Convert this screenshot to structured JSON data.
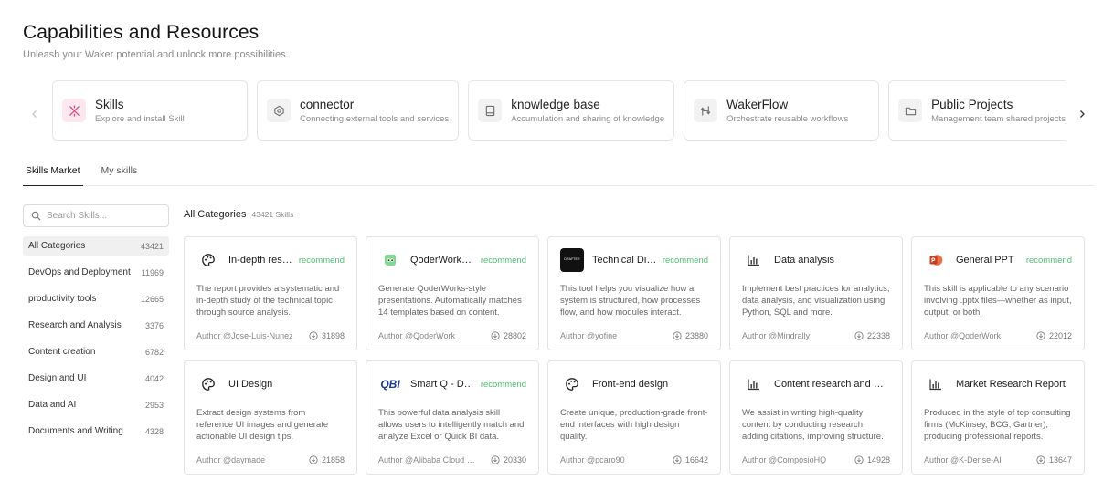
{
  "header": {
    "title": "Capabilities and Resources",
    "subtitle": "Unleash your Waker potential and unlock more possibilities."
  },
  "features": [
    {
      "title": "Skills",
      "desc": "Explore and install Skill",
      "icon": "sparkle-icon",
      "active": true
    },
    {
      "title": "connector",
      "desc": "Connecting external tools and services",
      "icon": "connector-icon"
    },
    {
      "title": "knowledge base",
      "desc": "Accumulation and sharing of knowledge",
      "icon": "book-icon"
    },
    {
      "title": "WakerFlow",
      "desc": "Orchestrate reusable workflows",
      "icon": "flow-icon"
    },
    {
      "title": "Public Projects",
      "desc": "Management team shared projects",
      "icon": "folder-icon"
    }
  ],
  "tabs": [
    {
      "label": "Skills Market",
      "active": true
    },
    {
      "label": "My skills"
    }
  ],
  "search": {
    "placeholder": "Search Skills..."
  },
  "categories": [
    {
      "label": "All Categories",
      "count": "43421",
      "active": true
    },
    {
      "label": "DevOps and Deployment",
      "count": "11969"
    },
    {
      "label": "productivity tools",
      "count": "12665"
    },
    {
      "label": "Research and Analysis",
      "count": "3376"
    },
    {
      "label": "Content creation",
      "count": "6782"
    },
    {
      "label": "Design and UI",
      "count": "4042"
    },
    {
      "label": "Data and AI",
      "count": "2953"
    },
    {
      "label": "Documents and Writing",
      "count": "4328"
    }
  ],
  "section": {
    "title": "All Categories",
    "count": "43421 Skills"
  },
  "skills": [
    {
      "name": "In-depth research",
      "recommend": "recommend",
      "icon": "palette-icon",
      "desc": "The report provides a systematic and in-depth study of the technical topic through source analysis.",
      "author": "Author @Jose-Luis-Nunez",
      "downloads": "31898"
    },
    {
      "name": "QoderWorks PPT",
      "recommend": "recommend",
      "icon": "mascot-icon",
      "desc": "Generate QoderWorks-style presentations. Automatically matches 14 templates based on content.",
      "author": "Author @QoderWork",
      "downloads": "28802"
    },
    {
      "name": "Technical Diagram",
      "recommend": "recommend",
      "icon": "dark-logo-icon",
      "icon_text": "DRAFTER",
      "desc": "This tool helps you visualize how a system is structured, how processes flow, and how modules interact.",
      "author": "Author @yofine",
      "downloads": "23880"
    },
    {
      "name": "Data analysis",
      "recommend": "",
      "icon": "bar-chart-icon",
      "desc": "Implement best practices for analytics, data analysis, and visualization using Python, SQL and more.",
      "author": "Author @Mindrally",
      "downloads": "22338"
    },
    {
      "name": "General PPT",
      "recommend": "recommend",
      "icon": "powerpoint-icon",
      "desc": "This skill is applicable to any scenario involving .pptx files—whether as input, output, or both.",
      "author": "Author @QoderWork",
      "downloads": "22012"
    },
    {
      "name": "UI Design",
      "recommend": "",
      "icon": "palette-icon",
      "desc": "Extract design systems from reference UI images and generate actionable UI design tips.",
      "author": "Author @daymade",
      "downloads": "21858"
    },
    {
      "name": "Smart Q - Data Analysis",
      "recommend": "recommend",
      "icon": "qbi-logo-icon",
      "icon_text": "QBI",
      "desc": "This powerful data analysis skill allows users to intelligently match and analyze Excel or Quick BI data.",
      "author": "Author @Alibaba Cloud Quick BI",
      "downloads": "20330"
    },
    {
      "name": "Front-end design",
      "recommend": "",
      "icon": "palette-icon",
      "desc": "Create unique, production-grade front-end interfaces with high design quality.",
      "author": "Author @pcaro90",
      "downloads": "16642"
    },
    {
      "name": "Content research and writing",
      "recommend": "",
      "icon": "bar-chart-icon",
      "desc": "We assist in writing high-quality content by conducting research, adding citations, improving structure.",
      "author": "Author @ComposioHQ",
      "downloads": "14928"
    },
    {
      "name": "Market Research Report",
      "recommend": "",
      "icon": "bar-chart-icon",
      "desc": "Produced in the style of top consulting firms (McKinsey, BCG, Gartner), producing professional reports.",
      "author": "Author @K-Dense-AI",
      "downloads": "13647"
    }
  ],
  "colors": {
    "accent_pink": "#e0457a",
    "recommend_green": "#4cbf73"
  }
}
